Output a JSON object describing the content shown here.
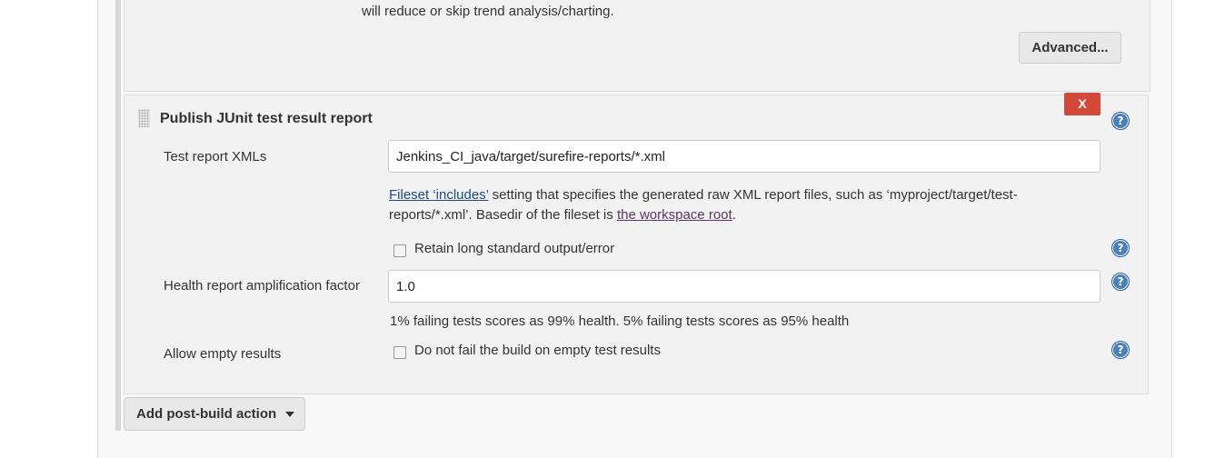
{
  "previous_section": {
    "description_tail": "will reduce or skip trend analysis/charting.",
    "advanced_label": "Advanced..."
  },
  "junit": {
    "title": "Publish JUnit test result report",
    "delete_label": "X",
    "help_glyph": "?",
    "test_report_xmls": {
      "label": "Test report XMLs",
      "value": "Jenkins_CI_java/target/surefire-reports/*.xml",
      "desc_link1": "Fileset ‘includes’",
      "desc_line1_rest": " setting that specifies the generated raw XML report files, such as ‘myproject/target/test-",
      "desc_line2_start": "reports/*.xml’. Basedir of the fileset is ",
      "desc_link2": "the workspace root",
      "desc_line2_end": "."
    },
    "retain_output": {
      "label": "Retain long standard output/error",
      "checked": false
    },
    "health_factor": {
      "label": "Health report amplification factor",
      "value": "1.0",
      "desc": "1% failing tests scores as 99% health. 5% failing tests scores as 95% health"
    },
    "allow_empty": {
      "label": "Allow empty results",
      "checkbox_label": "Do not fail the build on empty test results",
      "checked": false
    }
  },
  "add_post_build_action": {
    "label": "Add post-build action"
  },
  "icons": {
    "help": "help-icon",
    "caret": "chevron-down-icon",
    "drag": "drag-handle-icon"
  },
  "colors": {
    "delete_button": "#d24939",
    "help_icon": "#4a7fb8",
    "link": "#204a87"
  }
}
